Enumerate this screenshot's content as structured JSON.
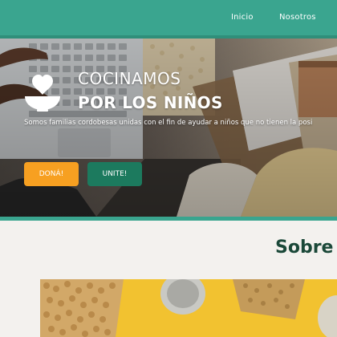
{
  "nav": {
    "links": [
      "Inicio",
      "Nosotros"
    ]
  },
  "hero": {
    "title_line1": "COCINAMOS",
    "title_line2": "POR LOS NIÑOS",
    "tagline": "Somos familias cordobesas unidas con el fin de ayudar a niños que no tienen la posi",
    "buttons": {
      "donate": "DONÁ!",
      "join": "UNITE!"
    },
    "logo_icon": "heart-bowl-icon"
  },
  "about": {
    "title": "Sobre n"
  },
  "colors": {
    "nav_bg": "#3aa58f",
    "donate_bg": "#f7a021",
    "join_bg": "#1c7a5e",
    "about_title": "#1a4838",
    "page_bg": "#f3f1ee"
  }
}
